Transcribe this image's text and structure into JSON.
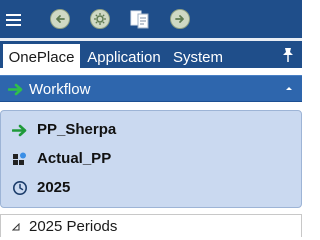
{
  "toolbar": {
    "menu_icon": "hamburger-menu-icon",
    "buttons": [
      {
        "icon": "back-arrow-icon"
      },
      {
        "icon": "settings-gear-icon"
      },
      {
        "icon": "documents-icon"
      },
      {
        "icon": "forward-arrow-icon"
      }
    ]
  },
  "tabs": [
    {
      "label": "OnePlace",
      "active": true
    },
    {
      "label": "Application",
      "active": false
    },
    {
      "label": "System",
      "active": false
    }
  ],
  "pin_icon": "pin-icon",
  "workflow": {
    "label": "Workflow",
    "icon": "green-arrow-icon",
    "expanded": true
  },
  "info": {
    "workflow_name": "PP_Sherpa",
    "scenario": "Actual_PP",
    "year": "2025"
  },
  "periods": {
    "label": "2025 Periods"
  },
  "colors": {
    "toolbar_bg": "#1f4e8a",
    "workflow_bar": "#2e66ad",
    "info_panel": "#cad9f0",
    "accent_green": "#1f9a3a"
  }
}
